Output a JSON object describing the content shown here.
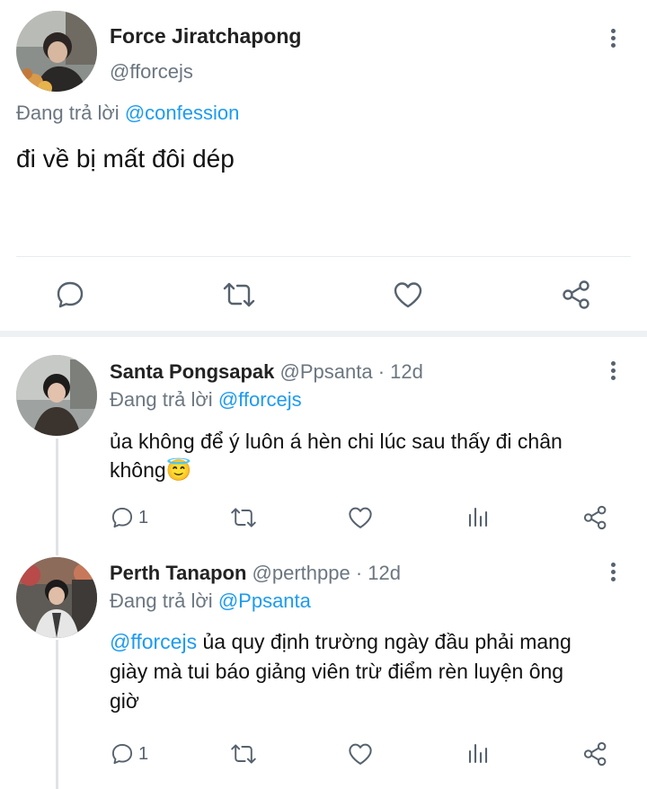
{
  "main_tweet": {
    "author_name": "Force Jiratchapong",
    "handle": "@fforcejs",
    "reply_prefix": "Đang trả lời",
    "reply_to": "@confession",
    "text": "đi về bị mất đôi dép",
    "actions": [
      "reply-icon",
      "retweet-icon",
      "like-icon",
      "share-icon"
    ]
  },
  "replies": [
    {
      "author_name": "Santa Pongsapak",
      "handle": "@Ppsanta",
      "time": "· 12d",
      "reply_prefix": "Đang trả lời",
      "reply_to": "@fforcejs",
      "text_line1": "ủa không để ý luôn á hèn chi lúc sau thấy đi chân",
      "text_line2": "không",
      "emoji": "😇",
      "reply_count": "1"
    },
    {
      "author_name": "Perth Tanapon",
      "handle": "@perthppe",
      "time": "· 12d",
      "reply_prefix": "Đang trả lời",
      "reply_to": "@Ppsanta",
      "mention": "@fforcejs",
      "text_line1": "ủa quy định trường ngày đầu phải mang",
      "text_line2": "giày mà tui báo giảng viên trừ điểm rèn luyện ông",
      "text_line3": "giờ",
      "reply_count": "1"
    }
  ],
  "colors": {
    "link": "#1d9bf0",
    "muted": "#6b7680",
    "icon": "#56626d",
    "divider": "#e6ecf0"
  }
}
